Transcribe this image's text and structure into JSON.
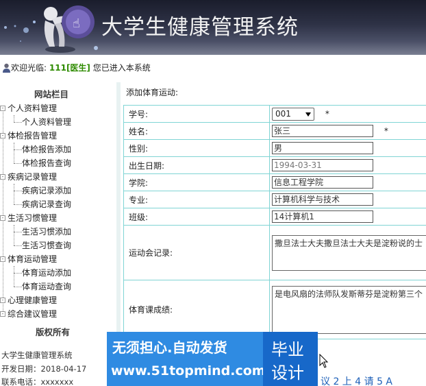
{
  "header": {
    "title": "大学生健康管理系统",
    "logo": "logo-figure-icon"
  },
  "welcome": {
    "prefix": "欢迎光临:",
    "user_id": "111",
    "role": "[医生]",
    "suffix": "您已进入本系统"
  },
  "sidebar": {
    "title": "网站栏目",
    "groups": [
      {
        "label": "个人资料管理",
        "items": [
          "个人资料管理"
        ]
      },
      {
        "label": "体检报告管理",
        "items": [
          "体检报告添加",
          "体检报告查询"
        ]
      },
      {
        "label": "疾病记录管理",
        "items": [
          "疾病记录添加",
          "疾病记录查询"
        ]
      },
      {
        "label": "生活习惯管理",
        "items": [
          "生活习惯添加",
          "生活习惯查询"
        ]
      },
      {
        "label": "体育运动管理",
        "items": [
          "体育运动添加",
          "体育运动查询"
        ]
      },
      {
        "label": "心理健康管理",
        "items": []
      },
      {
        "label": "综合建议管理",
        "items": []
      }
    ],
    "copyright_title": "版权所有",
    "info": {
      "system_name": "大学生健康管理系统",
      "dev_date": "开发日期：2018-04-17",
      "phone": "联系电话：xxxxxxx"
    }
  },
  "form": {
    "heading": "添加体育运动:",
    "fields": {
      "student_id": {
        "label": "学号:",
        "value": "001",
        "required": "*"
      },
      "name": {
        "label": "姓名:",
        "value": "张三",
        "required": "*"
      },
      "gender": {
        "label": "性别:",
        "value": "男"
      },
      "birth": {
        "label": "出生日期:",
        "value": "1994-03-31"
      },
      "college": {
        "label": "学院:",
        "value": "信息工程学院"
      },
      "major": {
        "label": "专业:",
        "value": "计算机科学与技术"
      },
      "class": {
        "label": "班级:",
        "value": "14计算机1"
      },
      "sports_record": {
        "label": "运动会记录:",
        "value": "撒旦法士大夫撒旦法士大夫是淀粉说的士"
      },
      "pe_score": {
        "label": "体育课成绩:",
        "value": "是电风扇的法师队发斯蒂芬是淀粉第三个"
      }
    }
  },
  "watermark": {
    "line1": "无须担心.自动发货",
    "line2": "www.51topmind.com",
    "right1": "毕业",
    "right2": "设计"
  },
  "pager": "议 2 上 4 请 5 A"
}
